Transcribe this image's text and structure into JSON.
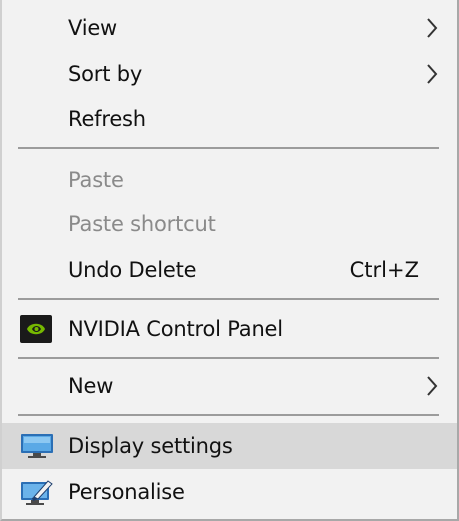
{
  "menu": {
    "items": {
      "view": {
        "label": "View",
        "icon": "chevron-right-icon"
      },
      "sort_by": {
        "label": "Sort by",
        "icon": "chevron-right-icon"
      },
      "refresh": {
        "label": "Refresh"
      },
      "paste": {
        "label": "Paste",
        "state": "disabled"
      },
      "paste_shortcut": {
        "label": "Paste shortcut",
        "state": "disabled"
      },
      "undo_delete": {
        "label": "Undo Delete",
        "shortcut": "Ctrl+Z"
      },
      "nvidia": {
        "label": "NVIDIA Control Panel",
        "icon": "nvidia-logo-icon"
      },
      "new": {
        "label": "New",
        "icon": "chevron-right-icon"
      },
      "display_settings": {
        "label": "Display settings",
        "icon": "monitor-icon",
        "state": "highlighted"
      },
      "personalise": {
        "label": "Personalise",
        "icon": "personalise-icon"
      }
    }
  },
  "colors": {
    "background": "#f2f2f2",
    "highlight": "#d8d8d8",
    "disabled_text": "#8a8a8a",
    "separator": "#9c9c9c",
    "nvidia_green": "#76b900"
  }
}
